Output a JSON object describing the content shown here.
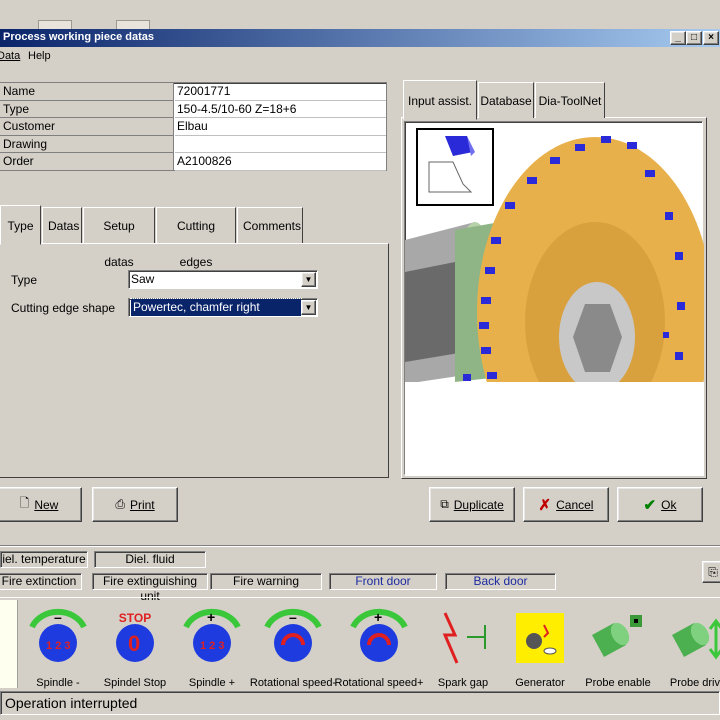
{
  "window": {
    "title": "Process working piece datas"
  },
  "menu": {
    "items": [
      "Data",
      "Help"
    ]
  },
  "piece": {
    "rows": [
      {
        "label": "Name",
        "value": "72001771"
      },
      {
        "label": "Type",
        "value": "150-4.5/10-60 Z=18+6"
      },
      {
        "label": "Customer",
        "value": "Elbau"
      },
      {
        "label": "Drawing",
        "value": ""
      },
      {
        "label": "Order",
        "value": "A2100826"
      }
    ]
  },
  "left_tabs": [
    "Type",
    "Datas",
    "Setup datas",
    "Cutting edges",
    "Comments"
  ],
  "type_panel": {
    "type_label": "Type",
    "type_value": "Saw",
    "shape_label": "Cutting edge shape",
    "shape_value": "Powertec, chamfer right"
  },
  "right_tabs": [
    "Input assist.",
    "Database",
    "Dia-ToolNet"
  ],
  "buttons": {
    "new": "New",
    "print": "Print",
    "duplicate": "Duplicate",
    "cancel": "Cancel",
    "ok": "Ok"
  },
  "indicators": {
    "row1": [
      "iel. temperature",
      "Diel. fluid"
    ],
    "row2": [
      "Fire extinction",
      "Fire extinguishing unit",
      "Fire warning",
      "Front door",
      "Back door"
    ]
  },
  "toolbar": [
    {
      "label": "Spindle -",
      "icon": "spindle-minus-icon"
    },
    {
      "label": "Spindel Stop",
      "icon": "spindle-stop-icon",
      "badge": "STOP"
    },
    {
      "label": "Spindle +",
      "icon": "spindle-plus-icon"
    },
    {
      "label": "Rotational speed-",
      "icon": "speed-minus-icon"
    },
    {
      "label": "Rotational speed+",
      "icon": "speed-plus-icon"
    },
    {
      "label": "Spark gap",
      "icon": "spark-gap-icon"
    },
    {
      "label": "Generator",
      "icon": "generator-icon"
    },
    {
      "label": "Probe enable",
      "icon": "probe-enable-icon"
    },
    {
      "label": "Probe drive",
      "icon": "probe-drive-icon"
    }
  ],
  "status": {
    "text": "Operation interrupted"
  },
  "colors": {
    "titlebar": "#0a246a",
    "selection": "#0a246a",
    "accent_blue": "#1c2aa0",
    "saw_gold": "#e8b04a",
    "tooth_blue": "#2a2ad8"
  }
}
